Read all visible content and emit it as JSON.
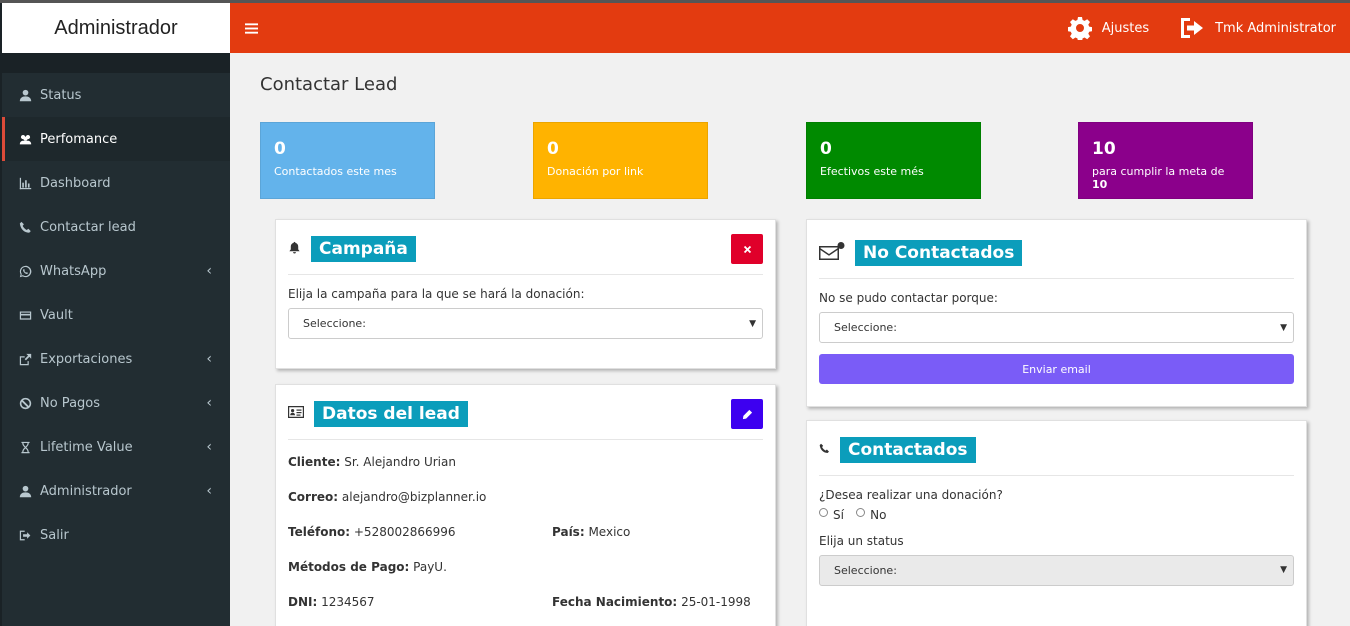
{
  "brand": "Administrador",
  "header": {
    "settings_label": "Ajustes",
    "user_label": "Tmk Administrator",
    "accent": "#e33b10"
  },
  "sidebar": {
    "items": [
      {
        "label": "Status",
        "icon": "user-icon"
      },
      {
        "label": "Perfomance",
        "icon": "users-icon",
        "active": true
      },
      {
        "label": "Dashboard",
        "icon": "bar-chart-icon"
      },
      {
        "label": "Contactar lead",
        "icon": "phone-icon"
      },
      {
        "label": "WhatsApp",
        "icon": "whatsapp-icon",
        "expandable": true
      },
      {
        "label": "Vault",
        "icon": "credit-card-icon"
      },
      {
        "label": "Exportaciones",
        "icon": "share-icon",
        "expandable": true
      },
      {
        "label": "No Pagos",
        "icon": "ban-icon",
        "expandable": true
      },
      {
        "label": "Lifetime Value",
        "icon": "hourglass-icon",
        "expandable": true
      },
      {
        "label": "Administrador",
        "icon": "user-icon",
        "expandable": true
      },
      {
        "label": "Salir",
        "icon": "sign-out-icon"
      }
    ]
  },
  "page": {
    "title": "Contactar Lead"
  },
  "stats": [
    {
      "value": "0",
      "label": "Contactados este mes",
      "color": "#63b3eb"
    },
    {
      "value": "0",
      "label": "Donación por link",
      "color": "#ffb300"
    },
    {
      "value": "0",
      "label": "Efectivos este més",
      "color": "#008a00"
    },
    {
      "value": "10",
      "label": "para cumplir la meta de ",
      "label_strong": "10",
      "color": "#8b008b"
    }
  ],
  "campana": {
    "title": "Campaña",
    "prompt": "Elija la campaña para la que se hará la donación:",
    "select_value": "Seleccione:"
  },
  "datos": {
    "title": "Datos del lead",
    "cliente_label": "Cliente:",
    "cliente": "Sr. Alejandro Urian",
    "correo_label": "Correo:",
    "correo": "alejandro@bizplanner.io",
    "telefono_label": "Teléfono:",
    "telefono": "+528002866996",
    "pais_label": "País:",
    "pais": "Mexico",
    "metodos_label": "Métodos de Pago:",
    "metodos": "PayU.",
    "dni_label": "DNI:",
    "dni": "1234567",
    "fecha_label": "Fecha Nacimiento:",
    "fecha": "25-01-1998"
  },
  "no_contactados": {
    "title": "No Contactados",
    "prompt": "No se pudo contactar porque:",
    "select_value": "Seleccione:",
    "button": "Enviar email"
  },
  "contactados": {
    "title": "Contactados",
    "question": "¿Desea realizar una donación?",
    "yes": "Sí",
    "no": "No",
    "status_label": "Elija un status",
    "select_value": "Seleccione:"
  }
}
